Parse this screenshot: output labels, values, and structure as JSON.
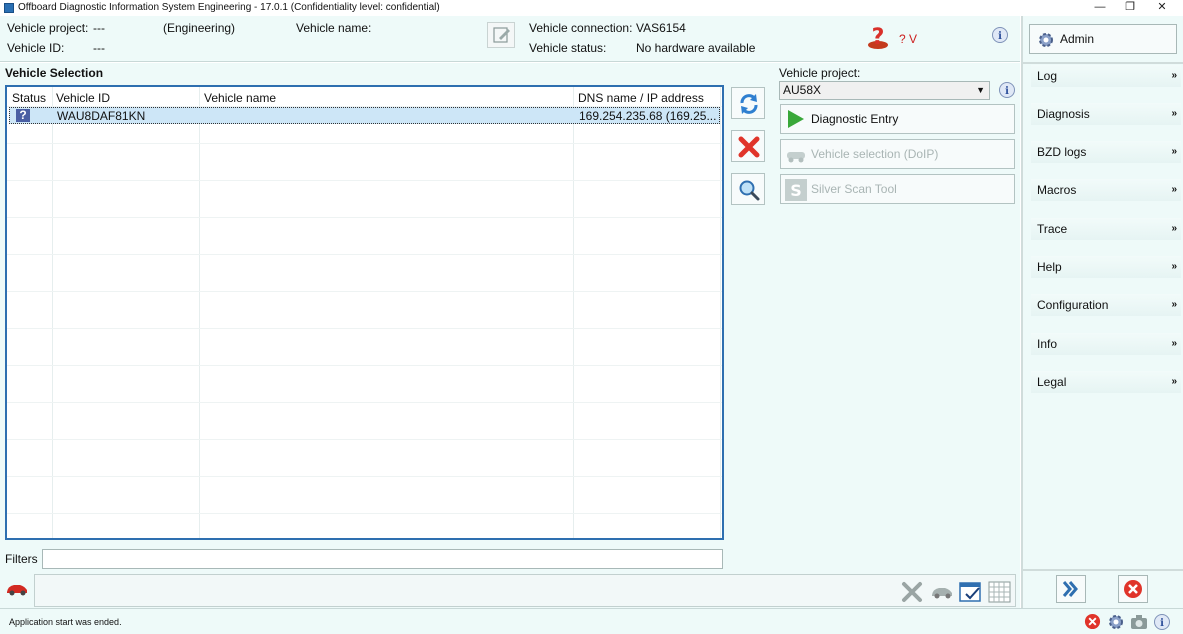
{
  "window": {
    "title": "Offboard Diagnostic Information System Engineering - 17.0.1 (Confidentiality level: confidential)",
    "minimize": "—",
    "maximize": "❐",
    "close": "✕"
  },
  "header": {
    "vehicle_project_label": "Vehicle project:",
    "vehicle_project_value": "---",
    "mode": "(Engineering)",
    "vehicle_name_label": "Vehicle name:",
    "vehicle_id_label": "Vehicle ID:",
    "vehicle_id_value": "---",
    "vehicle_connection_label": "Vehicle connection:",
    "vehicle_connection_value": "VAS6154",
    "vehicle_status_label": "Vehicle status:",
    "vehicle_status_value": "No hardware available",
    "voltage": "? V"
  },
  "vehicle_selection": {
    "title": "Vehicle Selection",
    "columns": [
      "Status",
      "Vehicle ID",
      "Vehicle name",
      "DNS name / IP address"
    ],
    "rows": [
      {
        "status": "?",
        "vehicle_id": "WAU8DAF81KN",
        "vehicle_name": "",
        "dns": "169.254.235.68 (169.25..."
      }
    ]
  },
  "project_panel": {
    "label": "Vehicle project:",
    "selected": "AU58X",
    "buttons": {
      "diagnostic_entry": "Diagnostic Entry",
      "vehicle_selection_doip": "Vehicle selection (DoIP)",
      "silver_scan_tool": "Silver Scan Tool"
    }
  },
  "filters": {
    "label": "Filters",
    "value": ""
  },
  "right_menu": {
    "admin": "Admin",
    "items": [
      "Log",
      "Diagnosis",
      "BZD logs",
      "Macros",
      "Trace",
      "Help",
      "Configuration",
      "Info",
      "Legal"
    ],
    "chevron": "»"
  },
  "status_bar": {
    "message": "Application start was ended."
  },
  "colors": {
    "accent": "#2e6fb0",
    "panel_bg": "#eefaf9",
    "selection": "#cde6f7",
    "error": "#d9302a",
    "go": "#3aa83a"
  }
}
